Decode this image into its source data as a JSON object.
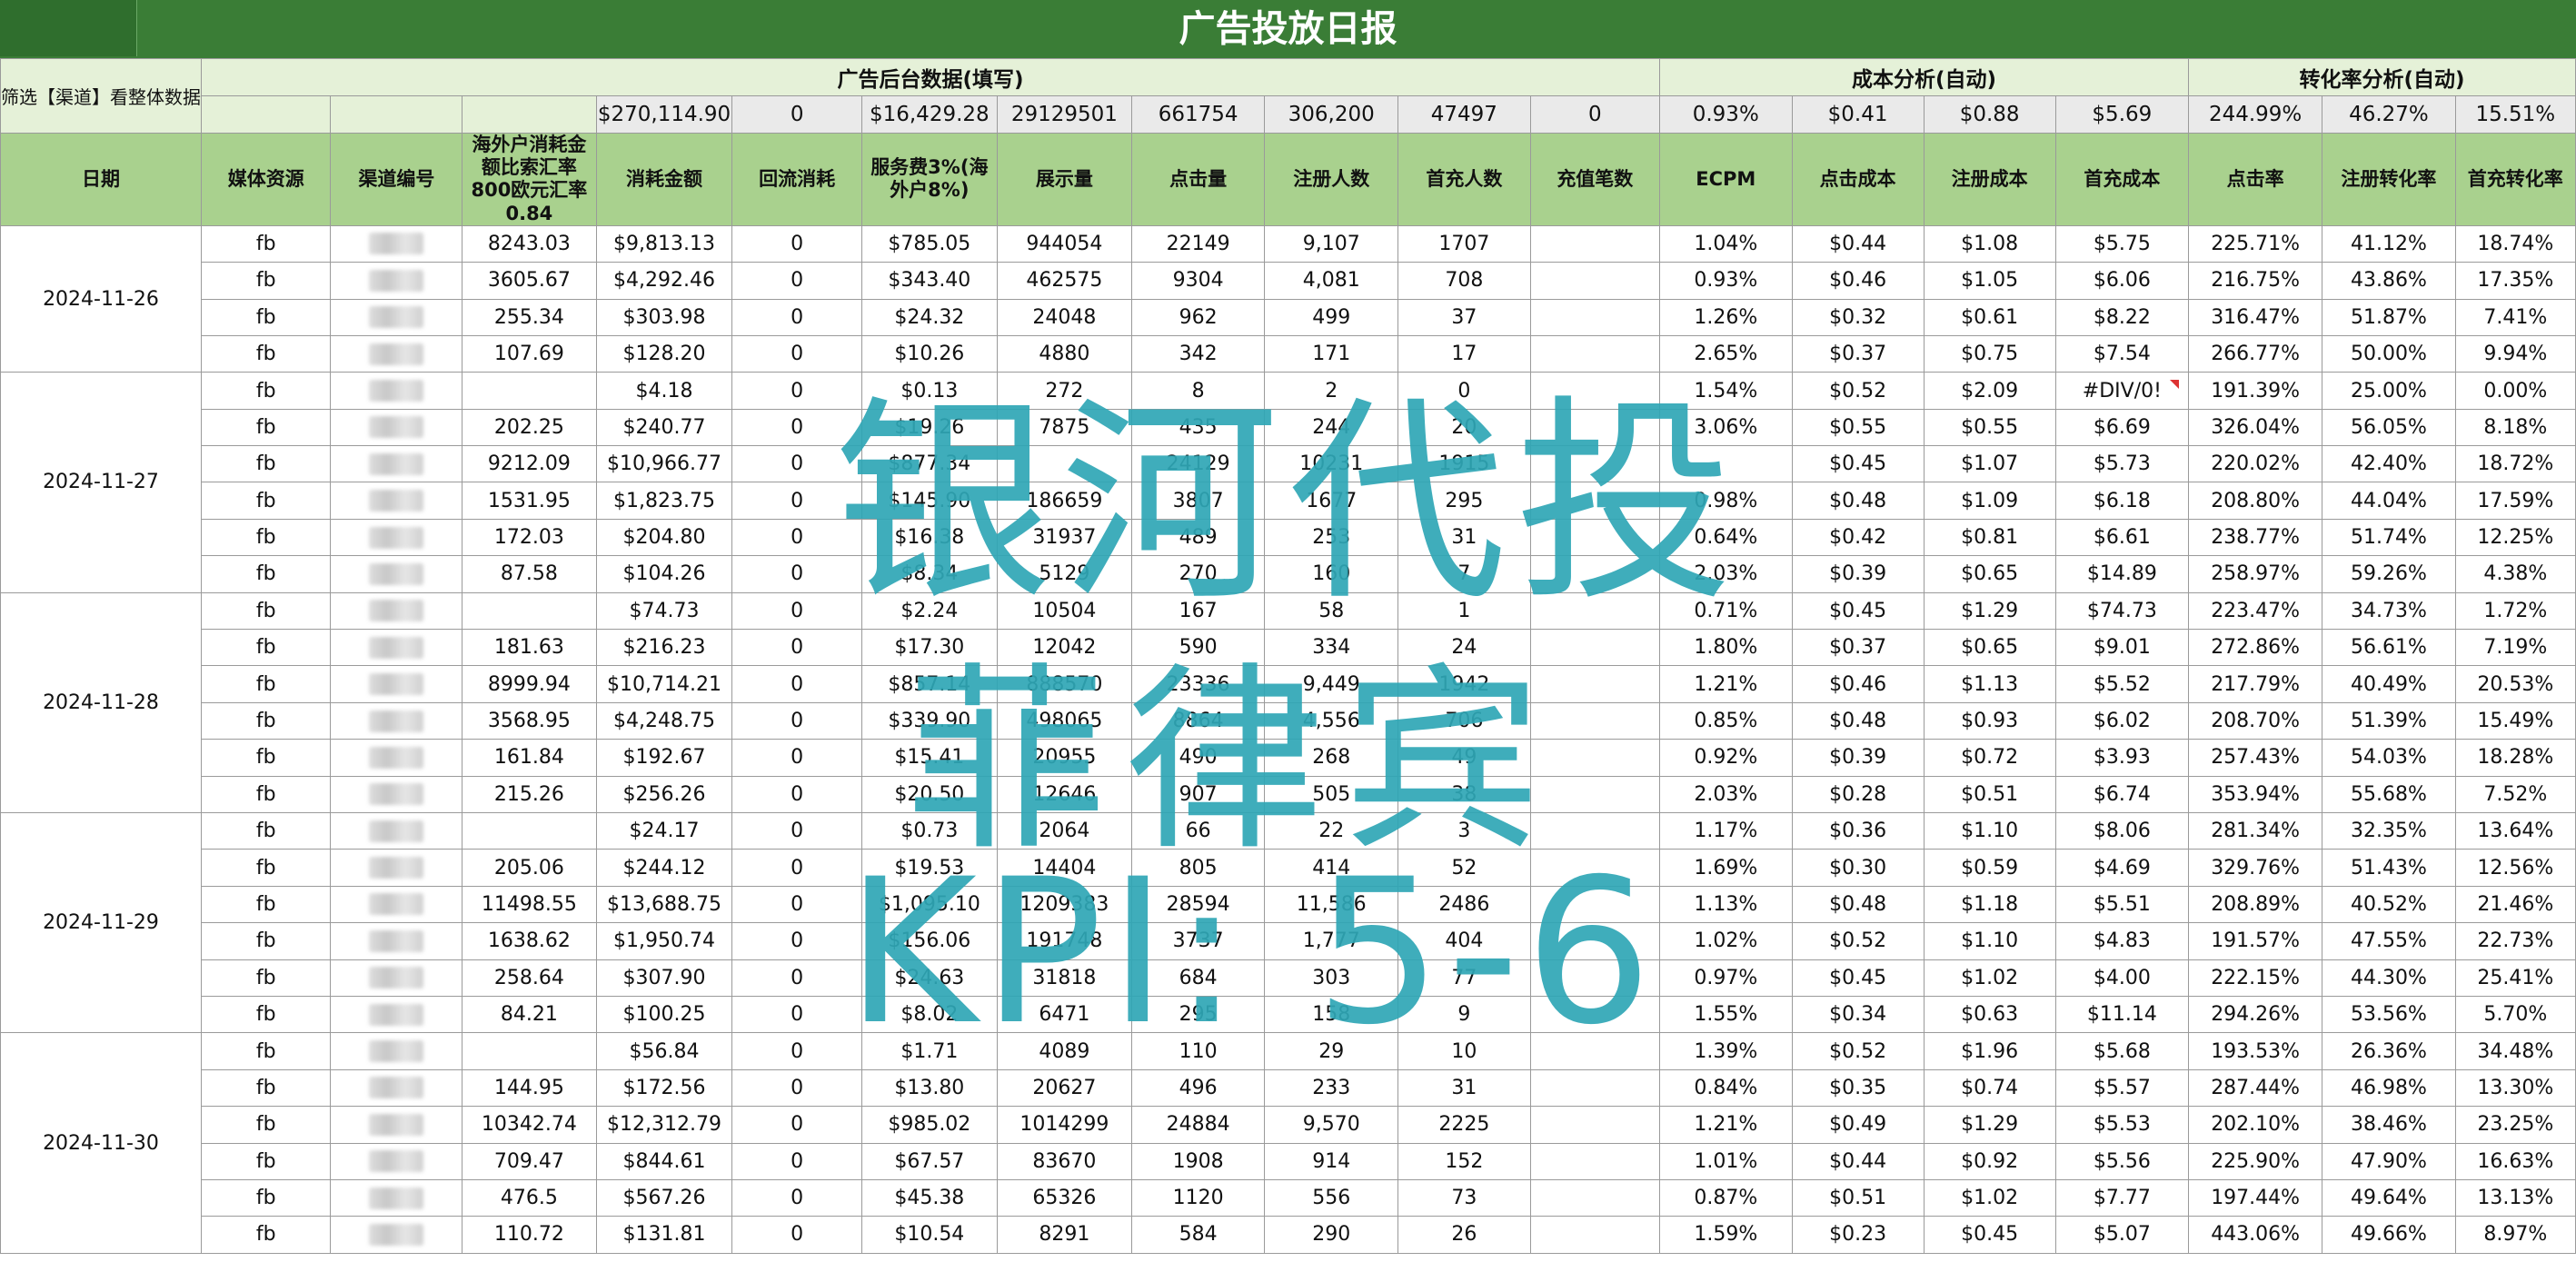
{
  "title": "广告投放日报",
  "filter_label": "筛选【渠道】看整体数据",
  "groups": {
    "backend": "广告后台数据(填写)",
    "cost": "成本分析(自动)",
    "conversion": "转化率分析(自动)"
  },
  "summary": [
    "",
    "",
    "",
    "",
    "$270,114.90",
    "0",
    "$16,429.28",
    "29129501",
    "661754",
    "306,200",
    "47497",
    "0",
    "0.93%",
    "$0.41",
    "$0.88",
    "$5.69",
    "244.99%",
    "46.27%",
    "15.51%"
  ],
  "headers": [
    "日期",
    "媒体资源",
    "渠道编号",
    "海外户消耗金额比索汇率800欧元汇率0.84",
    "消耗金额",
    "回流消耗",
    "服务费3%(海外户8%)",
    "展示量",
    "点击量",
    "注册人数",
    "首充人数",
    "充值笔数",
    "ECPM",
    "点击成本",
    "注册成本",
    "首充成本",
    "点击率",
    "注册转化率",
    "首充转化率"
  ],
  "dates": [
    "2024-11-26",
    "2024-11-27",
    "2024-11-28",
    "2024-11-29",
    "2024-11-30"
  ],
  "rows": [
    [
      "fb",
      "8243.03",
      "$9,813.13",
      "0",
      "$785.05",
      "944054",
      "22149",
      "9,107",
      "1707",
      "",
      "1.04%",
      "$0.44",
      "$1.08",
      "$5.75",
      "225.71%",
      "41.12%",
      "18.74%"
    ],
    [
      "fb",
      "3605.67",
      "$4,292.46",
      "0",
      "$343.40",
      "462575",
      "9304",
      "4,081",
      "708",
      "",
      "0.93%",
      "$0.46",
      "$1.05",
      "$6.06",
      "216.75%",
      "43.86%",
      "17.35%"
    ],
    [
      "fb",
      "255.34",
      "$303.98",
      "0",
      "$24.32",
      "24048",
      "962",
      "499",
      "37",
      "",
      "1.26%",
      "$0.32",
      "$0.61",
      "$8.22",
      "316.47%",
      "51.87%",
      "7.41%"
    ],
    [
      "fb",
      "107.69",
      "$128.20",
      "0",
      "$10.26",
      "4880",
      "342",
      "171",
      "17",
      "",
      "2.65%",
      "$0.37",
      "$0.75",
      "$7.54",
      "266.77%",
      "50.00%",
      "9.94%"
    ],
    [
      "fb",
      "",
      "$4.18",
      "0",
      "$0.13",
      "272",
      "8",
      "2",
      "0",
      "",
      "1.54%",
      "$0.52",
      "$2.09",
      "#DIV/0!",
      "191.39%",
      "25.00%",
      "0.00%"
    ],
    [
      "fb",
      "202.25",
      "$240.77",
      "0",
      "$19.26",
      "7875",
      "435",
      "244",
      "20",
      "",
      "3.06%",
      "$0.55",
      "$0.55",
      "$6.69",
      "326.04%",
      "56.05%",
      "8.18%"
    ],
    [
      "fb",
      "9212.09",
      "$10,966.77",
      "0",
      "$877.34",
      "",
      "24129",
      "10231",
      "1915",
      "",
      "",
      "$0.45",
      "$1.07",
      "$5.73",
      "220.02%",
      "42.40%",
      "18.72%"
    ],
    [
      "fb",
      "1531.95",
      "$1,823.75",
      "0",
      "$145.90",
      "186659",
      "3807",
      "1677",
      "295",
      "",
      "0.98%",
      "$0.48",
      "$1.09",
      "$6.18",
      "208.80%",
      "44.04%",
      "17.59%"
    ],
    [
      "fb",
      "172.03",
      "$204.80",
      "0",
      "$16.38",
      "31937",
      "489",
      "253",
      "31",
      "",
      "0.64%",
      "$0.42",
      "$0.81",
      "$6.61",
      "238.77%",
      "51.74%",
      "12.25%"
    ],
    [
      "fb",
      "87.58",
      "$104.26",
      "0",
      "$8.34",
      "5129",
      "270",
      "160",
      "7",
      "",
      "2.03%",
      "$0.39",
      "$0.65",
      "$14.89",
      "258.97%",
      "59.26%",
      "4.38%"
    ],
    [
      "fb",
      "",
      "$74.73",
      "0",
      "$2.24",
      "10504",
      "167",
      "58",
      "1",
      "",
      "0.71%",
      "$0.45",
      "$1.29",
      "$74.73",
      "223.47%",
      "34.73%",
      "1.72%"
    ],
    [
      "fb",
      "181.63",
      "$216.23",
      "0",
      "$17.30",
      "12042",
      "590",
      "334",
      "24",
      "",
      "1.80%",
      "$0.37",
      "$0.65",
      "$9.01",
      "272.86%",
      "56.61%",
      "7.19%"
    ],
    [
      "fb",
      "8999.94",
      "$10,714.21",
      "0",
      "$857.14",
      "888570",
      "23336",
      "9,449",
      "1942",
      "",
      "1.21%",
      "$0.46",
      "$1.13",
      "$5.52",
      "217.79%",
      "40.49%",
      "20.53%"
    ],
    [
      "fb",
      "3568.95",
      "$4,248.75",
      "0",
      "$339.90",
      "498065",
      "8864",
      "4,556",
      "706",
      "",
      "0.85%",
      "$0.48",
      "$0.93",
      "$6.02",
      "208.70%",
      "51.39%",
      "15.49%"
    ],
    [
      "fb",
      "161.84",
      "$192.67",
      "0",
      "$15.41",
      "20955",
      "490",
      "268",
      "49",
      "",
      "0.92%",
      "$0.39",
      "$0.72",
      "$3.93",
      "257.43%",
      "54.03%",
      "18.28%"
    ],
    [
      "fb",
      "215.26",
      "$256.26",
      "0",
      "$20.50",
      "12646",
      "907",
      "505",
      "38",
      "",
      "2.03%",
      "$0.28",
      "$0.51",
      "$6.74",
      "353.94%",
      "55.68%",
      "7.52%"
    ],
    [
      "fb",
      "",
      "$24.17",
      "0",
      "$0.73",
      "2064",
      "66",
      "22",
      "3",
      "",
      "1.17%",
      "$0.36",
      "$1.10",
      "$8.06",
      "281.34%",
      "32.35%",
      "13.64%"
    ],
    [
      "fb",
      "205.06",
      "$244.12",
      "0",
      "$19.53",
      "14404",
      "805",
      "414",
      "52",
      "",
      "1.69%",
      "$0.30",
      "$0.59",
      "$4.69",
      "329.76%",
      "51.43%",
      "12.56%"
    ],
    [
      "fb",
      "11498.55",
      "$13,688.75",
      "0",
      "$1,095.10",
      "1209383",
      "28594",
      "11,586",
      "2486",
      "",
      "1.13%",
      "$0.48",
      "$1.18",
      "$5.51",
      "208.89%",
      "40.52%",
      "21.46%"
    ],
    [
      "fb",
      "1638.62",
      "$1,950.74",
      "0",
      "$156.06",
      "191748",
      "3737",
      "1,777",
      "404",
      "",
      "1.02%",
      "$0.52",
      "$1.10",
      "$4.83",
      "191.57%",
      "47.55%",
      "22.73%"
    ],
    [
      "fb",
      "258.64",
      "$307.90",
      "0",
      "$24.63",
      "31818",
      "684",
      "303",
      "77",
      "",
      "0.97%",
      "$0.45",
      "$1.02",
      "$4.00",
      "222.15%",
      "44.30%",
      "25.41%"
    ],
    [
      "fb",
      "84.21",
      "$100.25",
      "0",
      "$8.02",
      "6471",
      "295",
      "158",
      "9",
      "",
      "1.55%",
      "$0.34",
      "$0.63",
      "$11.14",
      "294.26%",
      "53.56%",
      "5.70%"
    ],
    [
      "fb",
      "",
      "$56.84",
      "0",
      "$1.71",
      "4089",
      "110",
      "29",
      "10",
      "",
      "1.39%",
      "$0.52",
      "$1.96",
      "$5.68",
      "193.53%",
      "26.36%",
      "34.48%"
    ],
    [
      "fb",
      "144.95",
      "$172.56",
      "0",
      "$13.80",
      "20627",
      "496",
      "233",
      "31",
      "",
      "0.84%",
      "$0.35",
      "$0.74",
      "$5.57",
      "287.44%",
      "46.98%",
      "13.30%"
    ],
    [
      "fb",
      "10342.74",
      "$12,312.79",
      "0",
      "$985.02",
      "1014299",
      "24884",
      "9,570",
      "2225",
      "",
      "1.21%",
      "$0.49",
      "$1.29",
      "$5.53",
      "202.10%",
      "38.46%",
      "23.25%"
    ],
    [
      "fb",
      "709.47",
      "$844.61",
      "0",
      "$67.57",
      "83670",
      "1908",
      "914",
      "152",
      "",
      "1.01%",
      "$0.44",
      "$0.92",
      "$5.56",
      "225.90%",
      "47.90%",
      "16.63%"
    ],
    [
      "fb",
      "476.5",
      "$567.26",
      "0",
      "$45.38",
      "65326",
      "1120",
      "556",
      "73",
      "",
      "0.87%",
      "$0.51",
      "$1.02",
      "$7.77",
      "197.44%",
      "49.64%",
      "13.13%"
    ],
    [
      "fb",
      "110.72",
      "$131.81",
      "0",
      "$10.54",
      "8291",
      "584",
      "290",
      "26",
      "",
      "1.59%",
      "$0.23",
      "$0.45",
      "$5.07",
      "443.06%",
      "49.66%",
      "8.97%"
    ]
  ],
  "watermark": {
    "line1": "银河代投",
    "line2": "菲律宾",
    "line3": "KPI: 5-6"
  }
}
